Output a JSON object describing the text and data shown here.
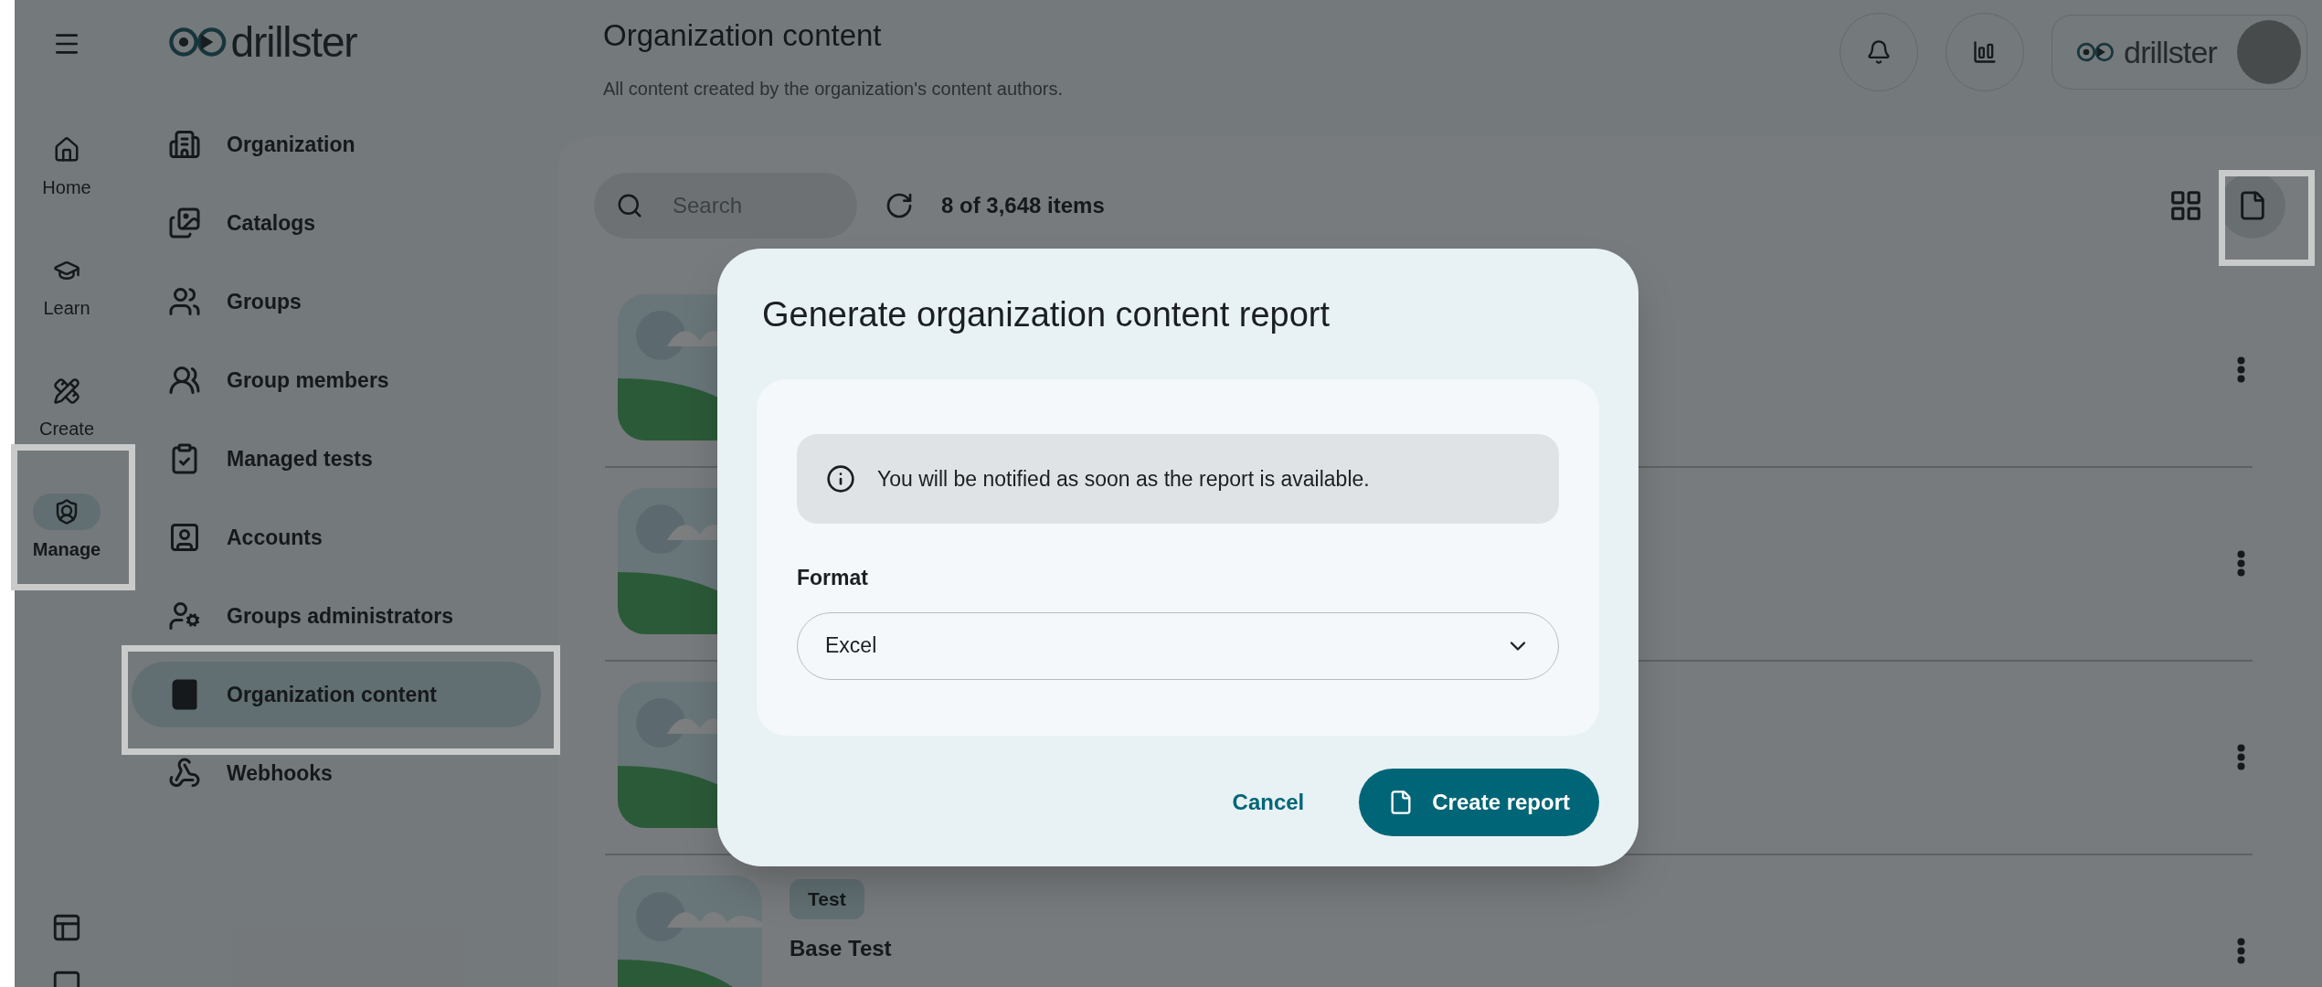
{
  "rail": {
    "items": [
      {
        "label": "Home",
        "selected": false
      },
      {
        "label": "Learn",
        "selected": false
      },
      {
        "label": "Create",
        "selected": false
      },
      {
        "label": "Manage",
        "selected": true
      }
    ]
  },
  "sidebar": {
    "brand": "drillster",
    "items": [
      {
        "label": "Organization",
        "selected": false
      },
      {
        "label": "Catalogs",
        "selected": false
      },
      {
        "label": "Groups",
        "selected": false
      },
      {
        "label": "Group members",
        "selected": false
      },
      {
        "label": "Managed tests",
        "selected": false
      },
      {
        "label": "Accounts",
        "selected": false
      },
      {
        "label": "Groups administrators",
        "selected": false
      },
      {
        "label": "Organization content",
        "selected": true
      },
      {
        "label": "Webhooks",
        "selected": false
      }
    ]
  },
  "header": {
    "title": "Organization content",
    "subtitle": "All content created by the organization's content authors.",
    "brand": "drillster"
  },
  "toolbar": {
    "search": {
      "placeholder": "Search"
    },
    "count": "8 of 3,648 items"
  },
  "items": [
    {
      "kind": "covered"
    },
    {
      "kind": "covered"
    },
    {
      "kind": "covered"
    },
    {
      "kind": "content",
      "tag": "Test",
      "title": "Base Test"
    }
  ],
  "dialog": {
    "title": "Generate organization content report",
    "notice": "You will be notified as soon as the report is available.",
    "format": {
      "label": "Format",
      "value": "Excel"
    },
    "buttons": [
      {
        "label": "Cancel",
        "kind": "text"
      },
      {
        "label": "Create report",
        "kind": "primary"
      }
    ]
  }
}
